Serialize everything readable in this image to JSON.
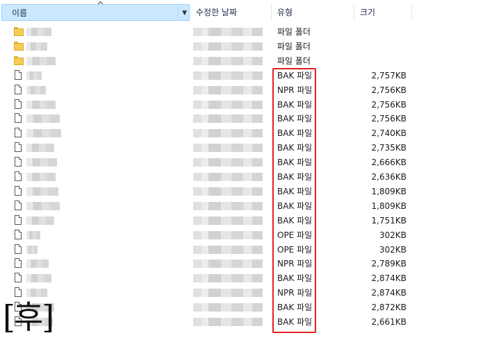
{
  "columns": {
    "name": "이름",
    "date": "수정한 날짜",
    "type": "유형",
    "size": "크기"
  },
  "icons": {
    "sort": "sort-ascending-icon",
    "dropdown": "chevron-down-icon",
    "folder": "folder-icon",
    "file": "file-icon"
  },
  "rows": [
    {
      "kind": "folder",
      "type": "파일 폴더",
      "size": ""
    },
    {
      "kind": "folder",
      "type": "파일 폴더",
      "size": ""
    },
    {
      "kind": "folder",
      "type": "파일 폴더",
      "size": ""
    },
    {
      "kind": "file",
      "type": "BAK 파일",
      "size": "2,757KB"
    },
    {
      "kind": "file",
      "type": "NPR 파일",
      "size": "2,756KB"
    },
    {
      "kind": "file",
      "type": "BAK 파일",
      "size": "2,756KB"
    },
    {
      "kind": "file",
      "type": "BAK 파일",
      "size": "2,756KB"
    },
    {
      "kind": "file",
      "type": "BAK 파일",
      "size": "2,740KB"
    },
    {
      "kind": "file",
      "type": "BAK 파일",
      "size": "2,735KB"
    },
    {
      "kind": "file",
      "type": "BAK 파일",
      "size": "2,666KB"
    },
    {
      "kind": "file",
      "type": "BAK 파일",
      "size": "2,636KB"
    },
    {
      "kind": "file",
      "type": "BAK 파일",
      "size": "1,809KB"
    },
    {
      "kind": "file",
      "type": "BAK 파일",
      "size": "1,809KB"
    },
    {
      "kind": "file",
      "type": "BAK 파일",
      "size": "1,751KB"
    },
    {
      "kind": "file",
      "type": "OPE 파일",
      "size": "302KB"
    },
    {
      "kind": "file",
      "type": "OPE 파일",
      "size": "302KB"
    },
    {
      "kind": "file",
      "type": "NPR 파일",
      "size": "2,789KB"
    },
    {
      "kind": "file",
      "type": "BAK 파일",
      "size": "2,874KB"
    },
    {
      "kind": "file",
      "type": "NPR 파일",
      "size": "2,874KB"
    },
    {
      "kind": "file",
      "type": "BAK 파일",
      "size": "2,872KB"
    },
    {
      "kind": "file",
      "type": "BAK 파일",
      "size": "2,661KB"
    }
  ],
  "watermark": "[후]",
  "colors": {
    "header_selected_bg": "#cce8ff",
    "highlight_border": "#e02020",
    "folder": "#f7cc55"
  }
}
